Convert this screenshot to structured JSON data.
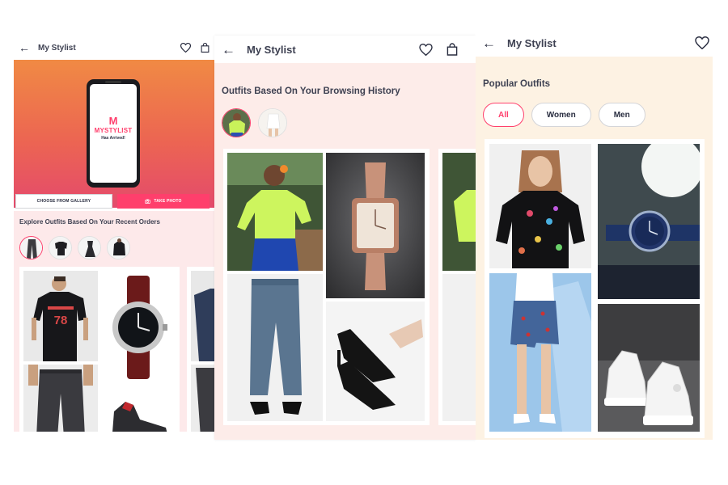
{
  "screen1": {
    "header": {
      "title": "My Stylist"
    },
    "hero": {
      "logo_mark": "M",
      "logo_text": "MYSTYLIST",
      "tagline": "Has Arrived!",
      "gallery_button": "CHOOSE FROM GALLERY",
      "photo_button": "TAKE PHOTO"
    },
    "section_title": "Explore Outfits Based On Your Recent Orders"
  },
  "screen2": {
    "header": {
      "title": "My Stylist"
    },
    "section_title": "Outfits Based On Your Browsing History"
  },
  "screen3": {
    "header": {
      "title": "My Stylist"
    },
    "section_title": "Popular Outfits",
    "chips": [
      "All",
      "Women",
      "Men"
    ],
    "selected_chip": "All"
  },
  "colors": {
    "accent": "#ff3f6c",
    "hero_top": "#f08a44",
    "hero_bottom": "#e44a6c",
    "section_pink": "#fde9ea",
    "section_cream": "#fdf2e3"
  },
  "icons": [
    "back-arrow-icon",
    "wishlist-heart-icon",
    "shopping-bag-icon",
    "camera-icon"
  ]
}
